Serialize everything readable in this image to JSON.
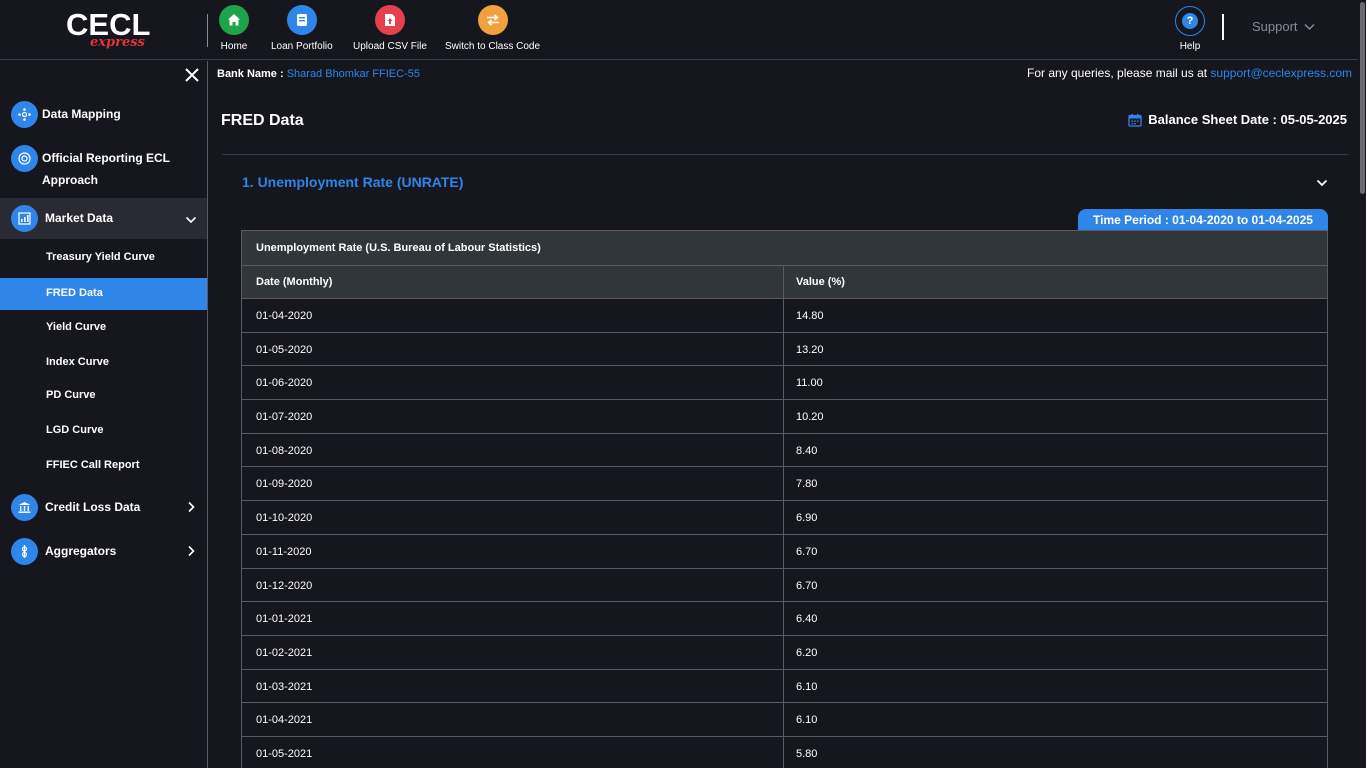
{
  "logo": {
    "main": "CECL",
    "sub": "express"
  },
  "nav": [
    {
      "label": "Home",
      "icon": "home-icon",
      "color": "#1fa34a"
    },
    {
      "label": "Loan Portfolio",
      "icon": "document-icon",
      "color": "#2f86e8"
    },
    {
      "label": "Upload CSV File",
      "icon": "upload-file-icon",
      "color": "#e5404e"
    },
    {
      "label": "Switch to Class Code",
      "icon": "switch-arrows-icon",
      "color": "#f0a03c"
    }
  ],
  "help": {
    "label": "Help"
  },
  "support": {
    "label": "Support"
  },
  "sidebar": {
    "items": [
      {
        "label": "Data Mapping"
      },
      {
        "label": "Official Reporting ECL",
        "label2": "Approach"
      },
      {
        "label": "Market Data"
      },
      {
        "label": "Credit Loss Data"
      },
      {
        "label": "Aggregators"
      }
    ],
    "sub_items": [
      {
        "label": "Treasury Yield Curve"
      },
      {
        "label": "FRED Data"
      },
      {
        "label": "Yield Curve"
      },
      {
        "label": "Index Curve"
      },
      {
        "label": "PD Curve"
      },
      {
        "label": "LGD Curve"
      },
      {
        "label": "FFIEC Call Report"
      }
    ]
  },
  "main": {
    "bank_label": "Bank Name :",
    "bank_value": "Sharad Bhomkar FFIEC-55",
    "queries_label": "For any queries, please mail us at",
    "queries_email": "support@ceclexpress.com",
    "page_title": "FRED Data",
    "balance_label": "Balance Sheet Date : 05-05-2025",
    "section_title": "1. Unemployment Rate (UNRATE)",
    "time_period": "Time Period : 01-04-2020 to 01-04-2025",
    "table": {
      "caption": "Unemployment Rate (U.S. Bureau of Labour Statistics)",
      "headers": [
        "Date (Monthly)",
        "Value (%)"
      ],
      "rows": [
        [
          "01-04-2020",
          "14.80"
        ],
        [
          "01-05-2020",
          "13.20"
        ],
        [
          "01-06-2020",
          "11.00"
        ],
        [
          "01-07-2020",
          "10.20"
        ],
        [
          "01-08-2020",
          "8.40"
        ],
        [
          "01-09-2020",
          "7.80"
        ],
        [
          "01-10-2020",
          "6.90"
        ],
        [
          "01-11-2020",
          "6.70"
        ],
        [
          "01-12-2020",
          "6.70"
        ],
        [
          "01-01-2021",
          "6.40"
        ],
        [
          "01-02-2021",
          "6.20"
        ],
        [
          "01-03-2021",
          "6.10"
        ],
        [
          "01-04-2021",
          "6.10"
        ],
        [
          "01-05-2021",
          "5.80"
        ]
      ]
    }
  },
  "colors": {
    "accent": "#2f86e8",
    "background": "#16161f",
    "table_header": "#30363a"
  }
}
